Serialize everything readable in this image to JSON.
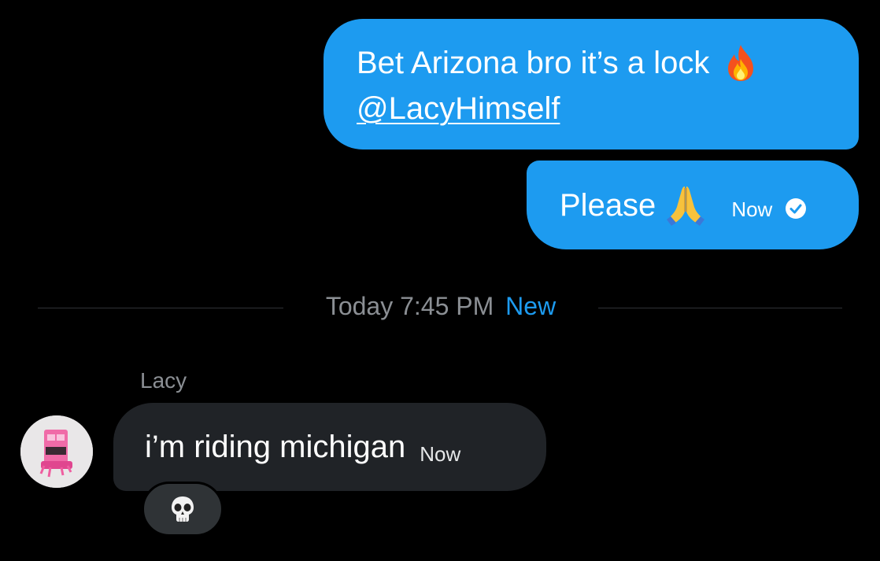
{
  "conversation": {
    "outgoing": [
      {
        "text": "Bet Arizona bro it’s a lock",
        "emoji": "fire-icon",
        "mention": "@LacyHimself"
      },
      {
        "text": "Please",
        "emoji": "folded-hands-icon",
        "time": "Now",
        "status_icon": "check-circle-icon"
      }
    ],
    "separator": {
      "date": "Today 7:45 PM",
      "new_label": "New"
    },
    "incoming": {
      "sender": "Lacy",
      "text": "i’m riding michigan",
      "time": "Now",
      "reaction": "skull-icon"
    }
  },
  "colors": {
    "background": "#000000",
    "outgoing_bubble": "#1d9bf0",
    "incoming_bubble": "#202327",
    "muted_text": "#8b8f94",
    "accent": "#1d9bf0"
  }
}
